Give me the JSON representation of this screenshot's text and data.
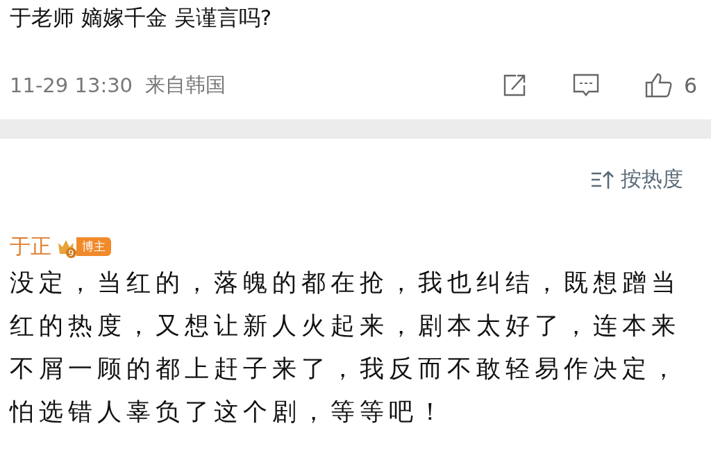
{
  "post": {
    "text": "于老师 嫡嫁千金 吴谨言吗?",
    "time": "11-29 13:30",
    "source": "来自韩国",
    "likes": "6"
  },
  "sort": {
    "label": "按热度"
  },
  "comments": [
    {
      "author": "于正",
      "level": "9",
      "badge": "博主",
      "text": "没定，当红的，落魄的都在抢，我也纠结，既想蹭当红的热度，又想让新人火起来，剧本太好了，连本来不屑一顾的都上赶子来了，我反而不敢轻易作决定，怕选错人辜负了这个剧，等等吧！"
    }
  ]
}
